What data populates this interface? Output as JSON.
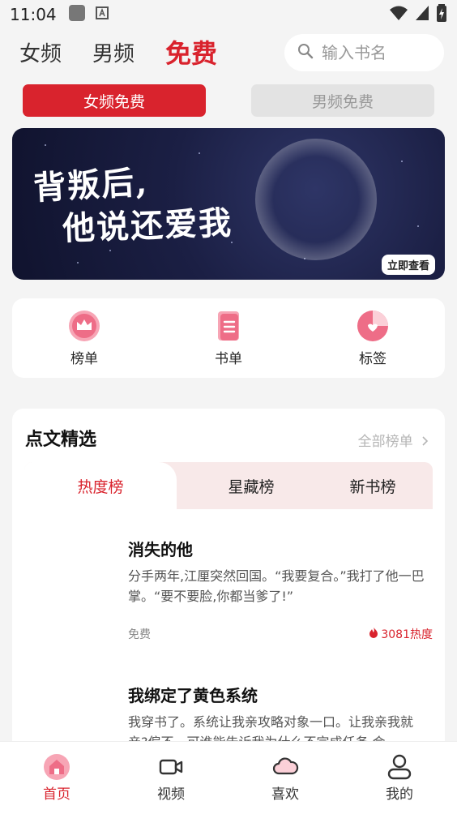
{
  "status_bar": {
    "time": "11:04"
  },
  "top_nav": {
    "tabs": [
      "女频",
      "男频",
      "免费"
    ],
    "active_tab": "免费",
    "search_placeholder": "输入书名"
  },
  "sub_tabs": {
    "on": "女频免费",
    "off": "男频免费"
  },
  "banner": {
    "line1": "背叛后,",
    "line2": "他说还爱我",
    "button": "立即查看"
  },
  "quick_entries": [
    "榜单",
    "书单",
    "标签"
  ],
  "section": {
    "title": "点文精选",
    "more": "全部榜单",
    "rank_tabs": [
      "热度榜",
      "星藏榜",
      "新书榜"
    ],
    "books": [
      {
        "title": "消失的他",
        "desc": "分手两年,江厘突然回国。“我要复合。”我打了他一巴掌。“要不要脸,你都当爹了!”",
        "tag": "免费",
        "heat": "3081热度"
      },
      {
        "title": "我绑定了黄色系统",
        "desc": "我穿书了。系统让我亲攻略对象一口。让我亲我就亲?偏不。可谁能告诉我为什么不完成任务,会..."
      }
    ]
  },
  "bottom_nav": [
    "首页",
    "视频",
    "喜欢",
    "我的"
  ],
  "colors": {
    "accent": "#d9232d",
    "pink": "#f6a8b8"
  }
}
